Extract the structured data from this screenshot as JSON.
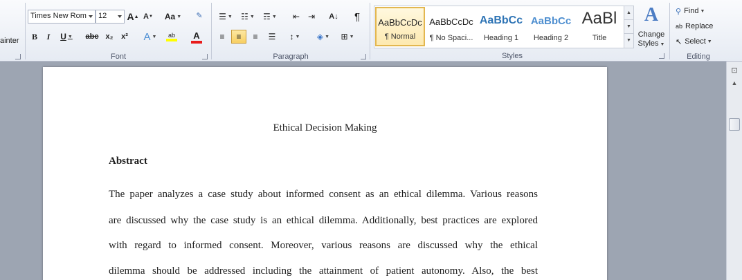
{
  "clipboard": {
    "painter_label": "ainter"
  },
  "font": {
    "group_label": "Font",
    "font_name": "Times New Rom",
    "font_size": "12",
    "grow_label": "A",
    "shrink_label": "A",
    "case_label": "Aa",
    "bold": "B",
    "italic": "I",
    "underline": "U",
    "strike": "abc",
    "subscript": "x₂",
    "superscript": "x²",
    "text_effects": "A",
    "highlight": "ab",
    "font_color": "A"
  },
  "paragraph": {
    "group_label": "Paragraph",
    "pilcrow": "¶"
  },
  "styles": {
    "group_label": "Styles",
    "items": [
      {
        "preview": "AaBbCcDc",
        "name": "¶ Normal"
      },
      {
        "preview": "AaBbCcDc",
        "name": "¶ No Spaci..."
      },
      {
        "preview": "AaBbCc",
        "name": "Heading 1"
      },
      {
        "preview": "AaBbCc",
        "name": "Heading 2"
      },
      {
        "preview": "AaBl",
        "name": "Title"
      }
    ],
    "change_styles": "Change Styles"
  },
  "editing": {
    "group_label": "Editing",
    "find": "Find",
    "replace": "Replace",
    "select": "Select"
  },
  "document": {
    "title": "Ethical Decision Making",
    "heading": "Abstract",
    "lines": [
      "The paper analyzes a case study about informed consent as an ethical dilemma. Various reasons",
      "are discussed why the case study is an ethical dilemma. Additionally, best practices are explored",
      "with regard to informed consent. Moreover, various reasons are discussed why the ethical",
      "dilemma should be addressed including the attainment of patient autonomy. Also, the best"
    ]
  },
  "colors": {
    "highlight": "#ffff00",
    "font_color": "#e81b1b",
    "heading_blue": "#2e74b5"
  }
}
